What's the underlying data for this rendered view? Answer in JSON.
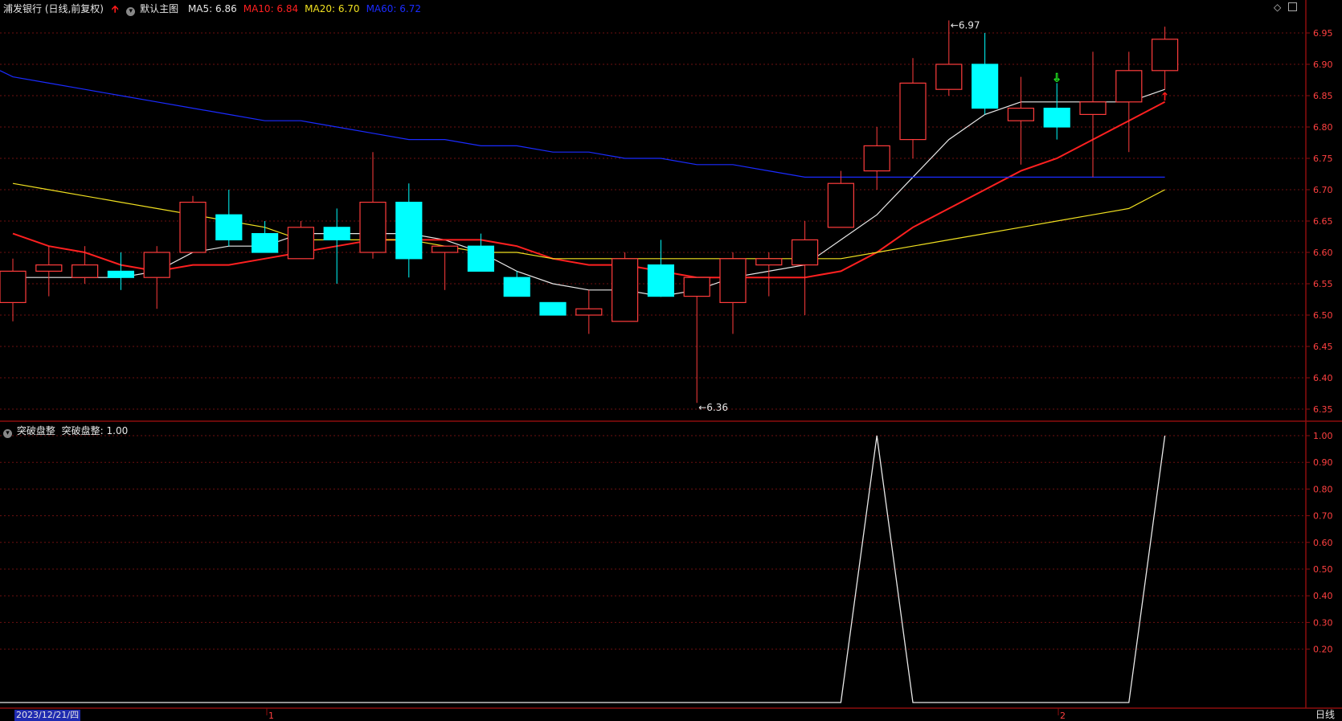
{
  "header": {
    "stock_title": "浦发银行 (日线,前复权)",
    "main_chart_name": "默认主图",
    "ma_items": [
      {
        "label": "MA5: 6.86",
        "color": "#e8e8e8"
      },
      {
        "label": "MA10: 6.84",
        "color": "#ff2020"
      },
      {
        "label": "MA20: 6.70",
        "color": "#f0e020"
      },
      {
        "label": "MA60: 6.72",
        "color": "#1a2bff"
      }
    ]
  },
  "indicator_header": {
    "name": "突破盘整",
    "value_label": "突破盘整: 1.00"
  },
  "bottom_bar": {
    "selected_date": "2023/12/21/四",
    "month_labels": [
      "1",
      "2"
    ],
    "period_tab": "日线"
  },
  "colors": {
    "up": "#ff3c3c",
    "down": "#00ffff",
    "grid": "#6e1010",
    "axis": "#8c0e0e",
    "price_label": "#ff4040",
    "buy_signal": "#ff1a1a",
    "sell_signal": "#22ee22",
    "indicator_line": "#e8e8e8"
  },
  "chart_data": [
    {
      "type": "candlestick",
      "title": "浦发银行 (日线,前复权)",
      "ylim": [
        6.32,
        7.0
      ],
      "y_ticks": [
        "6.95",
        "6.90",
        "6.85",
        "6.80",
        "6.75",
        "6.70",
        "6.65",
        "6.60",
        "6.55",
        "6.50",
        "6.45",
        "6.40",
        "6.35"
      ],
      "x": [
        "2023/12/21/四"
      ],
      "candles": [
        {
          "o": 6.52,
          "h": 6.59,
          "l": 6.49,
          "c": 6.57
        },
        {
          "o": 6.57,
          "h": 6.61,
          "l": 6.53,
          "c": 6.58
        },
        {
          "o": 6.56,
          "h": 6.61,
          "l": 6.55,
          "c": 6.58
        },
        {
          "o": 6.57,
          "h": 6.6,
          "l": 6.54,
          "c": 6.56
        },
        {
          "o": 6.56,
          "h": 6.61,
          "l": 6.51,
          "c": 6.6
        },
        {
          "o": 6.6,
          "h": 6.69,
          "l": 6.6,
          "c": 6.68
        },
        {
          "o": 6.66,
          "h": 6.7,
          "l": 6.61,
          "c": 6.62
        },
        {
          "o": 6.63,
          "h": 6.65,
          "l": 6.6,
          "c": 6.6
        },
        {
          "o": 6.59,
          "h": 6.65,
          "l": 6.59,
          "c": 6.64
        },
        {
          "o": 6.64,
          "h": 6.67,
          "l": 6.55,
          "c": 6.62
        },
        {
          "o": 6.6,
          "h": 6.76,
          "l": 6.59,
          "c": 6.68
        },
        {
          "o": 6.68,
          "h": 6.71,
          "l": 6.56,
          "c": 6.59
        },
        {
          "o": 6.6,
          "h": 6.61,
          "l": 6.54,
          "c": 6.61
        },
        {
          "o": 6.61,
          "h": 6.63,
          "l": 6.57,
          "c": 6.57
        },
        {
          "o": 6.56,
          "h": 6.57,
          "l": 6.53,
          "c": 6.53
        },
        {
          "o": 6.52,
          "h": 6.52,
          "l": 6.5,
          "c": 6.5
        },
        {
          "o": 6.5,
          "h": 6.54,
          "l": 6.47,
          "c": 6.51
        },
        {
          "o": 6.49,
          "h": 6.6,
          "l": 6.49,
          "c": 6.59
        },
        {
          "o": 6.58,
          "h": 6.62,
          "l": 6.53,
          "c": 6.53
        },
        {
          "o": 6.53,
          "h": 6.56,
          "l": 6.36,
          "c": 6.56
        },
        {
          "o": 6.52,
          "h": 6.6,
          "l": 6.47,
          "c": 6.59
        },
        {
          "o": 6.58,
          "h": 6.6,
          "l": 6.53,
          "c": 6.59
        },
        {
          "o": 6.58,
          "h": 6.65,
          "l": 6.5,
          "c": 6.62
        },
        {
          "o": 6.64,
          "h": 6.73,
          "l": 6.64,
          "c": 6.71
        },
        {
          "o": 6.73,
          "h": 6.8,
          "l": 6.7,
          "c": 6.77
        },
        {
          "o": 6.78,
          "h": 6.91,
          "l": 6.75,
          "c": 6.87
        },
        {
          "o": 6.86,
          "h": 6.97,
          "l": 6.85,
          "c": 6.9
        },
        {
          "o": 6.9,
          "h": 6.95,
          "l": 6.82,
          "c": 6.83
        },
        {
          "o": 6.81,
          "h": 6.88,
          "l": 6.74,
          "c": 6.83
        },
        {
          "o": 6.83,
          "h": 6.87,
          "l": 6.78,
          "c": 6.8
        },
        {
          "o": 6.82,
          "h": 6.92,
          "l": 6.72,
          "c": 6.84
        },
        {
          "o": 6.84,
          "h": 6.92,
          "l": 6.76,
          "c": 6.89
        },
        {
          "o": 6.89,
          "h": 6.96,
          "l": 6.86,
          "c": 6.94
        }
      ],
      "series": [
        {
          "name": "MA5",
          "color": "#e8e8e8",
          "values": [
            6.56,
            6.56,
            6.56,
            6.56,
            6.57,
            6.6,
            6.61,
            6.61,
            6.63,
            6.63,
            6.63,
            6.63,
            6.62,
            6.6,
            6.57,
            6.55,
            6.54,
            6.54,
            6.53,
            6.54,
            6.56,
            6.57,
            6.58,
            6.62,
            6.66,
            6.72,
            6.78,
            6.82,
            6.84,
            6.84,
            6.84,
            6.84,
            6.86
          ]
        },
        {
          "name": "MA10",
          "color": "#ff2020",
          "values": [
            6.63,
            6.61,
            6.6,
            6.58,
            6.57,
            6.58,
            6.58,
            6.59,
            6.6,
            6.61,
            6.62,
            6.62,
            6.62,
            6.62,
            6.61,
            6.59,
            6.58,
            6.58,
            6.57,
            6.56,
            6.56,
            6.56,
            6.56,
            6.57,
            6.6,
            6.64,
            6.67,
            6.7,
            6.73,
            6.75,
            6.78,
            6.81,
            6.84
          ]
        },
        {
          "name": "MA20",
          "color": "#f0e020",
          "values": [
            6.71,
            6.7,
            6.69,
            6.68,
            6.67,
            6.66,
            6.65,
            6.64,
            6.62,
            6.62,
            6.62,
            6.62,
            6.61,
            6.6,
            6.6,
            6.59,
            6.59,
            6.59,
            6.59,
            6.59,
            6.59,
            6.59,
            6.59,
            6.59,
            6.6,
            6.61,
            6.62,
            6.63,
            6.64,
            6.65,
            6.66,
            6.67,
            6.7
          ]
        },
        {
          "name": "MA60",
          "color": "#1a2bff",
          "values": [
            6.88,
            6.87,
            6.86,
            6.85,
            6.84,
            6.83,
            6.82,
            6.81,
            6.81,
            6.8,
            6.79,
            6.78,
            6.78,
            6.77,
            6.77,
            6.76,
            6.76,
            6.75,
            6.75,
            6.74,
            6.74,
            6.73,
            6.72,
            6.72,
            6.72,
            6.72,
            6.72,
            6.72,
            6.72,
            6.72,
            6.72,
            6.72,
            6.72
          ]
        }
      ],
      "annotations": [
        {
          "text": "6.97",
          "candle": 26,
          "price": 6.97
        },
        {
          "text": "6.36",
          "candle": 19,
          "price": 6.36
        }
      ],
      "signals": [
        {
          "type": "sell",
          "candle": 29,
          "price": 6.87
        },
        {
          "type": "buy",
          "candle": 32,
          "price": 6.85
        },
        {
          "type": "buy",
          "header": true
        }
      ]
    },
    {
      "type": "line",
      "title": "突破盘整",
      "ylim": [
        0,
        1.05
      ],
      "y_ticks": [
        "1.00",
        "0.90",
        "0.80",
        "0.70",
        "0.60",
        "0.50",
        "0.40",
        "0.30",
        "0.20"
      ],
      "series": [
        {
          "name": "突破盘整",
          "values": [
            0,
            0,
            0,
            0,
            0,
            0,
            0,
            0,
            0,
            0,
            0,
            0,
            0,
            0,
            0,
            0,
            0,
            0,
            0,
            0,
            0,
            0,
            0,
            0,
            1,
            0,
            0,
            0,
            0,
            0,
            0,
            0,
            1
          ]
        }
      ]
    }
  ]
}
